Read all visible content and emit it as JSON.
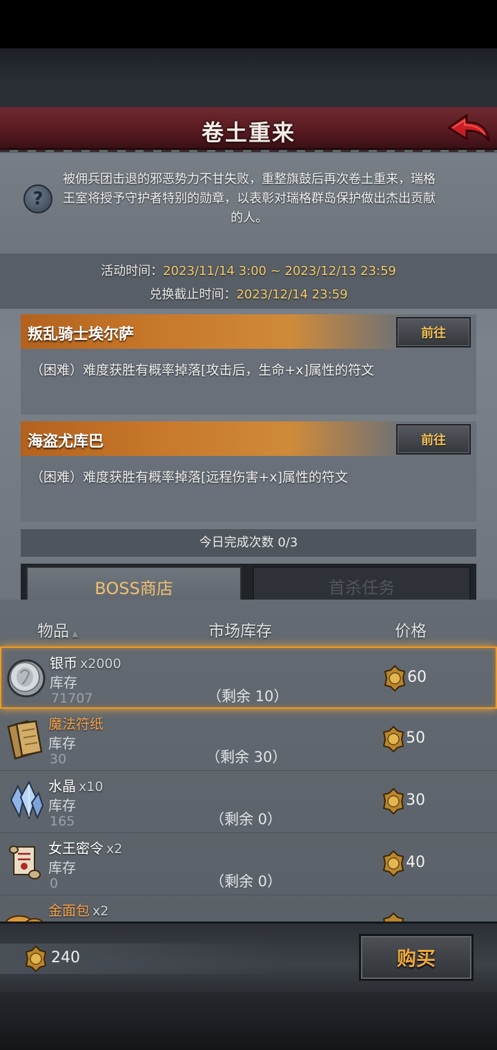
{
  "header": {
    "title": "卷土重来"
  },
  "description": "被佣兵团击退的邪恶势力不甘失败，重整旗鼓后再次卷土重来，瑞格王室将授予守护者特别的勋章，以表彰对瑞格群岛保护做出杰出贡献的人。",
  "event_time": {
    "label": "活动时间：",
    "value": "2023/11/14 3:00 ~ 2023/12/13 23:59"
  },
  "exchange_deadline": {
    "label": "兑换截止时间：",
    "value": "2023/12/14 23:59"
  },
  "bosses": [
    {
      "name": "叛乱骑士埃尔萨",
      "button": "前往",
      "desc": "（困难）难度获胜有概率掉落[攻击后，生命+x]属性的符文"
    },
    {
      "name": "海盗尤库巴",
      "button": "前往",
      "desc": "（困难）难度获胜有概率掉落[远程伤害+x]属性的符文"
    }
  ],
  "daily": {
    "label": "今日完成次数",
    "value": "0/3"
  },
  "tabs": {
    "boss_shop": "BOSS商店",
    "first_kill": "首杀任务"
  },
  "shop": {
    "columns": {
      "item": "物品",
      "sort_arrow": "▲",
      "stock": "市场库存",
      "price": "价格"
    },
    "stock_label": "库存",
    "items": [
      {
        "name": "银币",
        "qty": "x2000",
        "stock": "71707",
        "remain": "（剩余 10）",
        "price": "60",
        "icon": "silver-coin-icon"
      },
      {
        "name": "魔法符纸",
        "qty": "",
        "stock": "30",
        "remain": "（剩余 30）",
        "price": "50",
        "icon": "magic-paper-icon"
      },
      {
        "name": "水晶",
        "qty": "x10",
        "stock": "165",
        "remain": "（剩余 0）",
        "price": "30",
        "icon": "crystal-icon"
      },
      {
        "name": "女王密令",
        "qty": "x2",
        "stock": "0",
        "remain": "（剩余 0）",
        "price": "40",
        "icon": "queen-decree-icon"
      },
      {
        "name": "金面包",
        "qty": "x2",
        "stock": "",
        "remain": "",
        "price": "",
        "icon": "golden-bread-icon"
      }
    ]
  },
  "wallet": {
    "amount": "240"
  },
  "buy_button": "购买",
  "colors": {
    "accent_orange": "#f29a1c",
    "banner_red": "#5a1c22",
    "gold_text": "#f3c96a"
  }
}
